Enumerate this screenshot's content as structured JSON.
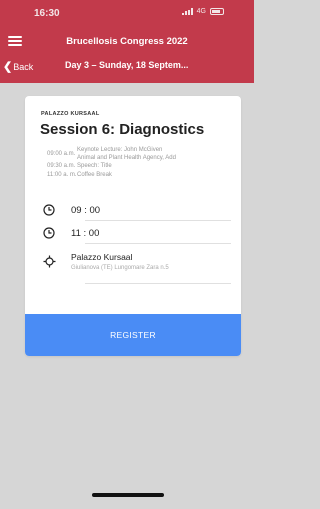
{
  "status": {
    "time": "16:30",
    "network": "4G"
  },
  "header": {
    "app_title": "Brucellosis Congress 2022",
    "back_label": "Back",
    "day_title": "Day 3 – Sunday, 18 Septem..."
  },
  "session": {
    "venue_label": "PALAZZO KURSAAL",
    "title": "Session 6: Diagnostics",
    "schedule": [
      {
        "time": "09:00 a.m.",
        "desc": "Keynote Lecture: John McGiven",
        "desc2": "Animal and Plant Health Agency, Add"
      },
      {
        "time": "09:30 a.m.",
        "desc": "Speech: Title"
      },
      {
        "time": "11:00 a. m.",
        "desc": "Coffee Break"
      }
    ],
    "start_time": "09 : 00",
    "end_time": "11 : 00",
    "location_name": "Palazzo Kursaal",
    "location_address": "Giulianova (TE) Lungomare Zara n.5",
    "register_label": "REGISTER"
  },
  "colors": {
    "header": "#c23a4b",
    "register": "#4a8cf5"
  }
}
